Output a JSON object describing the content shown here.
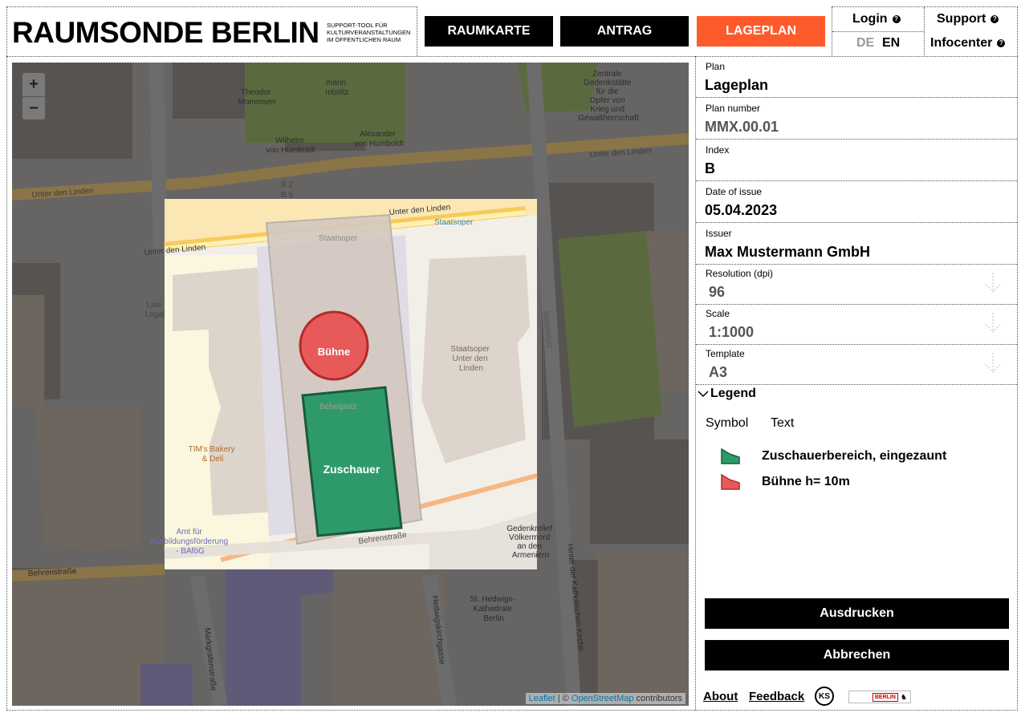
{
  "header": {
    "title": "RAUMSONDE BERLIN",
    "subtitle_lines": [
      "SUPPORT-TOOL FÜR",
      "KULTURVERANSTALTUNGEN",
      "IM ÖFFENTLICHEN RAUM"
    ],
    "nav": [
      {
        "label": "RAUMKARTE",
        "active": false
      },
      {
        "label": "ANTRAG",
        "active": false
      },
      {
        "label": "LAGEPLAN",
        "active": true
      }
    ],
    "login_label": "Login",
    "support_label": "Support",
    "infocenter_label": "Infocenter",
    "lang_de": "DE",
    "lang_en": "EN",
    "accent_color": "#ff5a2c"
  },
  "map": {
    "zoom_in": "+",
    "zoom_out": "−",
    "stage_label": "Bühne",
    "audience_label": "Zuschauer",
    "attribution_leaflet": "Leaflet",
    "attribution_sep": " | © ",
    "attribution_osm": "OpenStreetMap",
    "attribution_tail": " contributors",
    "labels": {
      "unter_den_linden": "Unter den Linden",
      "staatsoper": "Staatsoper",
      "staatsoper_full": [
        "Staatsoper",
        "Unter den",
        "Linden"
      ],
      "bebelplatz": "Bebelplatz",
      "behrenstrasse": "Behrenstraße",
      "tims_bakery": [
        "TIM's Bakery",
        "& Deli"
      ],
      "amt": [
        "Amt für",
        "Ausbildungsförderung",
        "- BAföG"
      ],
      "hedwig": [
        "St. Hedwigs-",
        "Kathedrale",
        "Berlin"
      ],
      "theodor": [
        "Theodor",
        "Mommsen"
      ],
      "wilhelm": [
        "Wilhelm",
        "von Humboldt"
      ],
      "alexander": [
        "Alexander",
        "von Humboldt"
      ],
      "gedenk": [
        "Zentrale",
        "Gedenkstätte",
        "für die",
        "Opfer von",
        "Krieg und",
        "Gewaltherrschaft"
      ],
      "law": [
        "Law",
        "Legal"
      ],
      "hedwigskirchgasse": "Hedwigskirchgasse",
      "markgrafenstrasse": "Markgrafenstraße",
      "hinter_kath": "Hinter der Katholischen Kirche",
      "bebelplatz_road": "Bebelplatz",
      "gedenkrelief": [
        "Gedenkrelief",
        "Völkermord",
        "an den",
        "Armeniern"
      ],
      "b2": "B 2",
      "b5": "B 5",
      "mann": [
        "mann",
        "mboltz"
      ]
    }
  },
  "panel": {
    "plan": {
      "label": "Plan",
      "value": "Lageplan"
    },
    "plan_number": {
      "label": "Plan number",
      "value": "MMX.00.01"
    },
    "index": {
      "label": "Index",
      "value": "B"
    },
    "date": {
      "label": "Date of issue",
      "value": "05.04.2023"
    },
    "issuer": {
      "label": "Issuer",
      "value": "Max Mustermann GmbH"
    },
    "resolution": {
      "label": "Resolution (dpi)",
      "value": "96"
    },
    "scale": {
      "label": "Scale",
      "value": "1:1000"
    },
    "template": {
      "label": "Template",
      "value": "A3"
    },
    "legend": {
      "title": "Legend",
      "col_symbol": "Symbol",
      "col_text": "Text",
      "items": [
        {
          "text": "Zuschauerbereich, eingezaunt",
          "color": "#2e9a6a",
          "icon": "audience-area-swatch"
        },
        {
          "text": "Bühne h= 10m",
          "color": "#e85a5a",
          "icon": "stage-area-swatch"
        }
      ]
    },
    "print_label": "Ausdrucken",
    "cancel_label": "Abbrechen",
    "about_label": "About",
    "feedback_label": "Feedback",
    "ks_logo": "KS",
    "berlin_wordmark": "BERLIN"
  }
}
